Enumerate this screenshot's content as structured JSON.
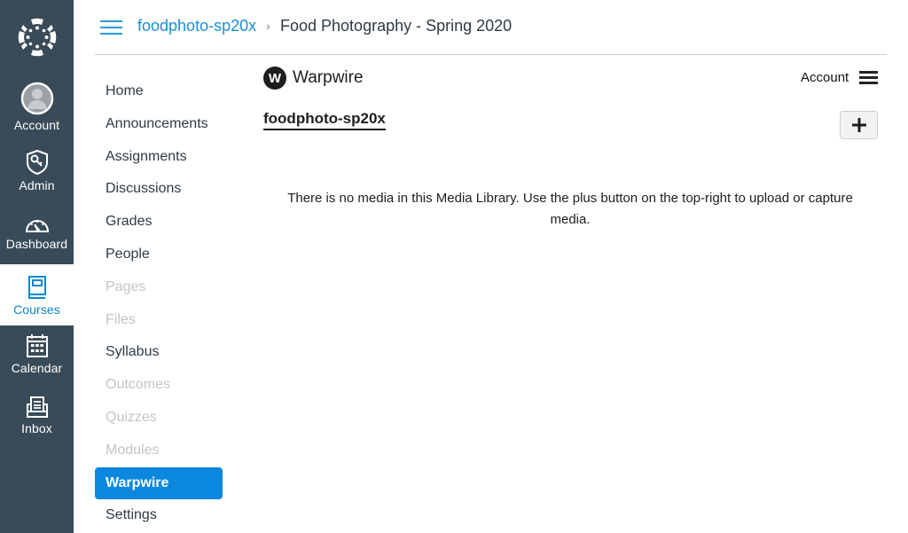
{
  "global_nav": {
    "items": [
      {
        "id": "account",
        "label": "Account",
        "icon": "avatar-icon",
        "active": false
      },
      {
        "id": "admin",
        "label": "Admin",
        "icon": "shield-key-icon",
        "active": false
      },
      {
        "id": "dashboard",
        "label": "Dashboard",
        "icon": "speedometer-icon",
        "active": false
      },
      {
        "id": "courses",
        "label": "Courses",
        "icon": "book-icon",
        "active": true
      },
      {
        "id": "calendar",
        "label": "Calendar",
        "icon": "calendar-icon",
        "active": false
      },
      {
        "id": "inbox",
        "label": "Inbox",
        "icon": "inbox-icon",
        "active": false
      }
    ]
  },
  "header": {
    "breadcrumb_link": "foodphoto-sp20x",
    "breadcrumb_separator": "›",
    "breadcrumb_current": "Food Photography - Spring 2020"
  },
  "course_nav": {
    "items": [
      {
        "label": "Home",
        "state": "enabled"
      },
      {
        "label": "Announcements",
        "state": "enabled"
      },
      {
        "label": "Assignments",
        "state": "enabled"
      },
      {
        "label": "Discussions",
        "state": "enabled"
      },
      {
        "label": "Grades",
        "state": "enabled"
      },
      {
        "label": "People",
        "state": "enabled"
      },
      {
        "label": "Pages",
        "state": "disabled"
      },
      {
        "label": "Files",
        "state": "disabled"
      },
      {
        "label": "Syllabus",
        "state": "enabled"
      },
      {
        "label": "Outcomes",
        "state": "disabled"
      },
      {
        "label": "Quizzes",
        "state": "disabled"
      },
      {
        "label": "Modules",
        "state": "disabled"
      },
      {
        "label": "Warpwire",
        "state": "active"
      },
      {
        "label": "Settings",
        "state": "enabled"
      }
    ]
  },
  "warpwire": {
    "logo_letter": "W",
    "brand": "Warpwire",
    "account_label": "Account",
    "library_title": "foodphoto-sp20x",
    "add_button": "+",
    "empty_message": "There is no media in this Media Library. Use the plus button on the top-right to upload or capture media."
  },
  "colors": {
    "nav_bg": "#394b58",
    "accent": "#0b87dd",
    "link": "#1a8ed4",
    "disabled_text": "#c0c5ca"
  }
}
